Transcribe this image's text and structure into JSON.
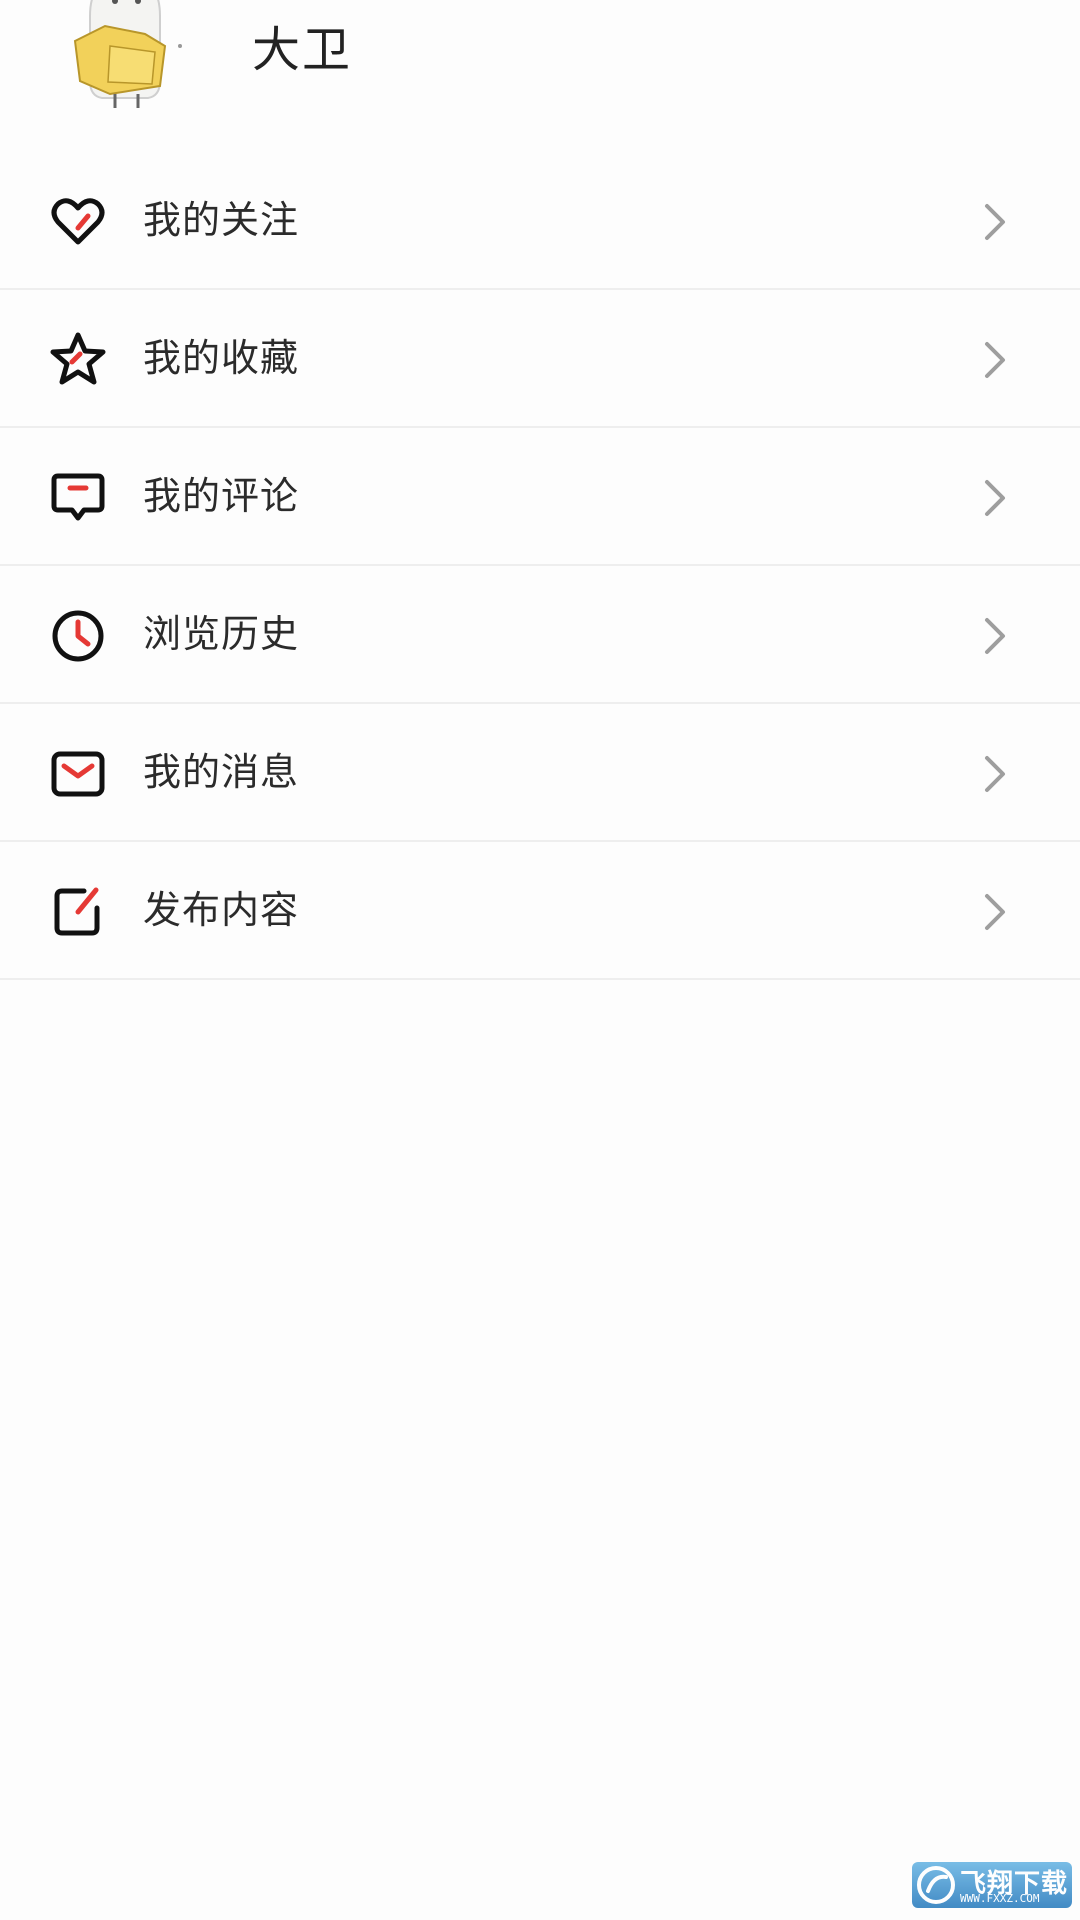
{
  "profile": {
    "username": "大卫"
  },
  "menu": {
    "items": [
      {
        "label": "我的关注",
        "icon": "heart-icon"
      },
      {
        "label": "我的收藏",
        "icon": "star-icon"
      },
      {
        "label": "我的评论",
        "icon": "comment-icon"
      },
      {
        "label": "浏览历史",
        "icon": "clock-icon"
      },
      {
        "label": "我的消息",
        "icon": "mail-icon"
      },
      {
        "label": "发布内容",
        "icon": "edit-icon"
      }
    ]
  },
  "watermark": {
    "cn": "飞翔下载",
    "en": "WWW.FXXZ.COM"
  },
  "colors": {
    "accent": "#e53935",
    "icon_stroke": "#111111",
    "chevron": "#9e9e9e",
    "divider": "#eeeeee"
  }
}
